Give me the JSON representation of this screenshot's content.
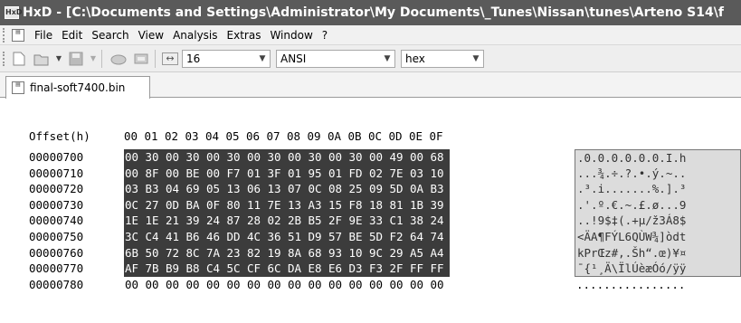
{
  "window": {
    "title": "HxD - [C:\\Documents and Settings\\Administrator\\My Documents\\_Tunes\\Nissan\\tunes\\Arteno S14\\f",
    "app_icon": "HxD"
  },
  "menubar": {
    "items": [
      "File",
      "Edit",
      "Search",
      "View",
      "Analysis",
      "Extras",
      "Window",
      "?"
    ]
  },
  "toolbar": {
    "bytes_per_row": "16",
    "charset": "ANSI",
    "offset_base": "hex"
  },
  "tabs": [
    {
      "label": "final-soft7400.bin"
    }
  ],
  "hex_view": {
    "offset_header": "Offset(h)",
    "column_headers": [
      "00",
      "01",
      "02",
      "03",
      "04",
      "05",
      "06",
      "07",
      "08",
      "09",
      "0A",
      "0B",
      "0C",
      "0D",
      "0E",
      "0F"
    ],
    "rows": [
      {
        "offset": "00000700",
        "bytes": [
          "00",
          "30",
          "00",
          "30",
          "00",
          "30",
          "00",
          "30",
          "00",
          "30",
          "00",
          "30",
          "00",
          "49",
          "00",
          "68"
        ],
        "ascii": ".0.0.0.0.0.0.I.h"
      },
      {
        "offset": "00000710",
        "bytes": [
          "00",
          "8F",
          "00",
          "BE",
          "00",
          "F7",
          "01",
          "3F",
          "01",
          "95",
          "01",
          "FD",
          "02",
          "7E",
          "03",
          "10"
        ],
        "ascii": "...¾.÷.?.•.ý.~.."
      },
      {
        "offset": "00000720",
        "bytes": [
          "03",
          "B3",
          "04",
          "69",
          "05",
          "13",
          "06",
          "13",
          "07",
          "0C",
          "08",
          "25",
          "09",
          "5D",
          "0A",
          "B3"
        ],
        "ascii": ".³.i.......%.].³"
      },
      {
        "offset": "00000730",
        "bytes": [
          "0C",
          "27",
          "0D",
          "BA",
          "0F",
          "80",
          "11",
          "7E",
          "13",
          "A3",
          "15",
          "F8",
          "18",
          "81",
          "1B",
          "39"
        ],
        "ascii": ".'.º.€.~.£.ø...9"
      },
      {
        "offset": "00000740",
        "bytes": [
          "1E",
          "1E",
          "21",
          "39",
          "24",
          "87",
          "28",
          "02",
          "2B",
          "B5",
          "2F",
          "9E",
          "33",
          "C1",
          "38",
          "24"
        ],
        "ascii": "..!9$‡(.+µ/ž3Á8$"
      },
      {
        "offset": "00000750",
        "bytes": [
          "3C",
          "C4",
          "41",
          "B6",
          "46",
          "DD",
          "4C",
          "36",
          "51",
          "D9",
          "57",
          "BE",
          "5D",
          "F2",
          "64",
          "74"
        ],
        "ascii": "<ÄA¶FÝL6QÙW¾]òdt"
      },
      {
        "offset": "00000760",
        "bytes": [
          "6B",
          "50",
          "72",
          "8C",
          "7A",
          "23",
          "82",
          "19",
          "8A",
          "68",
          "93",
          "10",
          "9C",
          "29",
          "A5",
          "A4"
        ],
        "ascii": "kPrŒz#‚.Šh“.œ)¥¤"
      },
      {
        "offset": "00000770",
        "bytes": [
          "AF",
          "7B",
          "B9",
          "B8",
          "C4",
          "5C",
          "CF",
          "6C",
          "DA",
          "E8",
          "E6",
          "D3",
          "F3",
          "2F",
          "FF",
          "FF"
        ],
        "ascii": "¯{¹¸Ä\\ÏlÚèæÓó/ÿÿ"
      },
      {
        "offset": "00000780",
        "bytes": [
          "00",
          "00",
          "00",
          "00",
          "00",
          "00",
          "00",
          "00",
          "00",
          "00",
          "00",
          "00",
          "00",
          "00",
          "00",
          "00"
        ],
        "ascii": "................"
      }
    ],
    "selected_rows": 8
  },
  "colors": {
    "titlebar": "#5a5a5a",
    "selection": "#3c3c3c",
    "selection_text": "#ffffff"
  }
}
